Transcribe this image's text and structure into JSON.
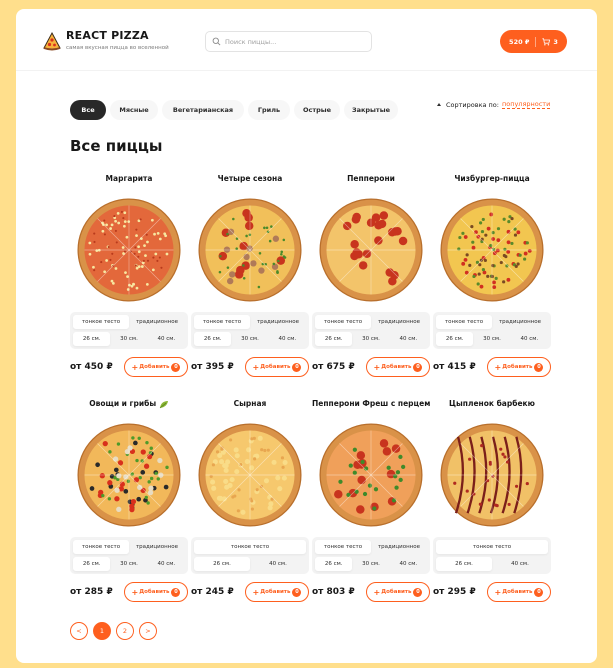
{
  "header": {
    "title": "REACT PIZZA",
    "subtitle": "самая вкусная пицца во вселенной",
    "search_placeholder": "Поиск пиццы...",
    "cart_total": "520 ₽",
    "cart_count": "3",
    "logo_icon": "pizza-logo-icon",
    "search_icon": "search-icon",
    "cart_icon": "cart-icon",
    "accent_color": "#fe5f1e"
  },
  "categories": [
    {
      "label": "Все",
      "active": true
    },
    {
      "label": "Мясные",
      "active": false
    },
    {
      "label": "Вегетарианская",
      "active": false
    },
    {
      "label": "Гриль",
      "active": false
    },
    {
      "label": "Острые",
      "active": false
    },
    {
      "label": "Закрытые",
      "active": false
    }
  ],
  "sort": {
    "label": "Сортировка по:",
    "value": "популярности"
  },
  "page_title": "Все пиццы",
  "add_label": "Добавить",
  "pizzas": [
    {
      "name": "Маргарита",
      "price": "от 450 ₽",
      "doughs": [
        "тонкое тесто",
        "традиционное"
      ],
      "dough_sel": 0,
      "sizes": [
        "26 см.",
        "30 см.",
        "40 см."
      ],
      "size_sel": 0,
      "count": "0",
      "style": "margarita"
    },
    {
      "name": "Четыре сезона",
      "price": "от 395 ₽",
      "doughs": [
        "тонкое тесто",
        "традиционное"
      ],
      "dough_sel": 0,
      "sizes": [
        "26 см.",
        "30 см.",
        "40 см."
      ],
      "size_sel": 0,
      "count": "0",
      "style": "seasons"
    },
    {
      "name": "Пепперони",
      "price": "от 675 ₽",
      "doughs": [
        "тонкое тесто",
        "традиционное"
      ],
      "dough_sel": 0,
      "sizes": [
        "26 см.",
        "30 см.",
        "40 см."
      ],
      "size_sel": 0,
      "count": "0",
      "style": "pepperoni"
    },
    {
      "name": "Чизбургер-пицца",
      "price": "от 415 ₽",
      "doughs": [
        "тонкое тесто",
        "традиционное"
      ],
      "dough_sel": 0,
      "sizes": [
        "26 см.",
        "30 см.",
        "40 см."
      ],
      "size_sel": 0,
      "count": "0",
      "style": "cheeseburger"
    },
    {
      "name": "Овощи и грибы",
      "price": "от 285 ₽",
      "doughs": [
        "тонкое тесто",
        "традиционное"
      ],
      "dough_sel": 0,
      "sizes": [
        "26 см.",
        "30 см.",
        "40 см."
      ],
      "size_sel": 0,
      "count": "0",
      "style": "veggie",
      "leaf": true
    },
    {
      "name": "Сырная",
      "price": "от 245 ₽",
      "doughs": [
        "тонкое тесто"
      ],
      "dough_sel": 0,
      "sizes": [
        "26 см.",
        "40 см."
      ],
      "size_sel": 0,
      "count": "0",
      "style": "cheese"
    },
    {
      "name": "Пепперони Фреш с перцем",
      "price": "от 803 ₽",
      "doughs": [
        "тонкое тесто",
        "традиционное"
      ],
      "dough_sel": 0,
      "sizes": [
        "26 см.",
        "30 см.",
        "40 см."
      ],
      "size_sel": 0,
      "count": "0",
      "style": "fresh"
    },
    {
      "name": "Цыпленок барбекю",
      "price": "от 295 ₽",
      "doughs": [
        "тонкое тесто"
      ],
      "dough_sel": 0,
      "sizes": [
        "26 см.",
        "40 см."
      ],
      "size_sel": 0,
      "count": "0",
      "style": "bbq"
    }
  ],
  "pagination": {
    "prev": "<",
    "pages": [
      "1",
      "2"
    ],
    "active": "1",
    "next": ">"
  }
}
